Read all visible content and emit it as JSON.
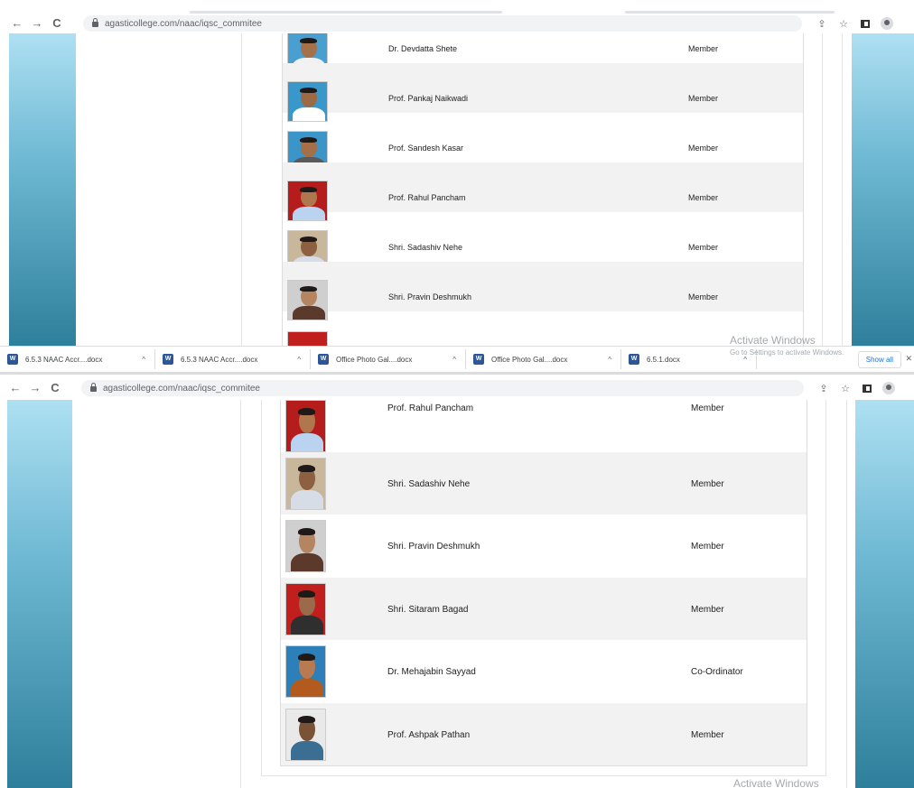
{
  "browser": {
    "url": "agasticollege.com/naac/iqsc_commitee",
    "nav_back": "←",
    "nav_forward": "→",
    "nav_reload": "C",
    "share_icon": "⇪",
    "star_icon": "☆"
  },
  "top_members": [
    {
      "name": "Dr. Devdatta Shete",
      "role": "Member",
      "photo": {
        "bg": "#4a9fd1",
        "body": "#f1f1f1",
        "skin": "#a4714b"
      }
    },
    {
      "name": "Prof. Pankaj Naikwadi",
      "role": "Member",
      "photo": {
        "bg": "#3a97c9",
        "body": "#ffffff",
        "skin": "#9c6a45"
      }
    },
    {
      "name": "Prof. Sandesh Kasar",
      "role": "Member",
      "photo": {
        "bg": "#3b95c8",
        "body": "#5a5a5a",
        "skin": "#a56f47"
      }
    },
    {
      "name": "Prof. Rahul Pancham",
      "role": "Member",
      "photo": {
        "bg": "#b51c1c",
        "body": "#b9d3f0",
        "skin": "#b0764d"
      }
    },
    {
      "name": "Shri. Sadashiv Nehe",
      "role": "Member",
      "photo": {
        "bg": "#c8b79a",
        "body": "#d7dde6",
        "skin": "#8c6040"
      }
    },
    {
      "name": "Shri. Pravin Deshmukh",
      "role": "Member",
      "photo": {
        "bg": "#cfcfcf",
        "body": "#5b3a2c",
        "skin": "#b58460"
      }
    }
  ],
  "bottom_members": [
    {
      "name": "Prof. Rahul Pancham",
      "role": "Member",
      "photo": {
        "bg": "#b51c1c",
        "body": "#b9d3f0",
        "skin": "#b0764d"
      }
    },
    {
      "name": "Shri. Sadashiv Nehe",
      "role": "Member",
      "photo": {
        "bg": "#c8b79a",
        "body": "#d7dde6",
        "skin": "#8c6040"
      }
    },
    {
      "name": "Shri. Pravin Deshmukh",
      "role": "Member",
      "photo": {
        "bg": "#cfcfcf",
        "body": "#5b3a2c",
        "skin": "#b58460"
      }
    },
    {
      "name": "Shri. Sitaram Bagad",
      "role": "Member",
      "photo": {
        "bg": "#c11e1e",
        "body": "#2f2f2f",
        "skin": "#9a6a4a"
      }
    },
    {
      "name": "Dr. Mehajabin Sayyad",
      "role": "Co-Ordinator",
      "photo": {
        "bg": "#2c7fb8",
        "body": "#b35a1e",
        "skin": "#b87a50"
      }
    },
    {
      "name": "Prof. Ashpak Pathan",
      "role": "Member",
      "photo": {
        "bg": "#e9e9e9",
        "body": "#3a6e93",
        "skin": "#7a5236"
      }
    }
  ],
  "downloads": {
    "items": [
      {
        "label": "6.5.3  NAAC Accr....docx"
      },
      {
        "label": "6.5.3  NAAC Accr....docx"
      },
      {
        "label": "Office  Photo Gal....docx"
      },
      {
        "label": "Office  Photo Gal....docx"
      },
      {
        "label": "6.5.1.docx"
      }
    ],
    "show_all": "Show all",
    "chevron": "^"
  },
  "watermark": {
    "title": "Activate Windows",
    "subtitle": "Go to Settings to activate Windows."
  },
  "colors": {
    "side_panel_top": "#aee0f2",
    "side_panel_bottom": "#2e7f9b",
    "row_alt": "#f2f2f2"
  }
}
